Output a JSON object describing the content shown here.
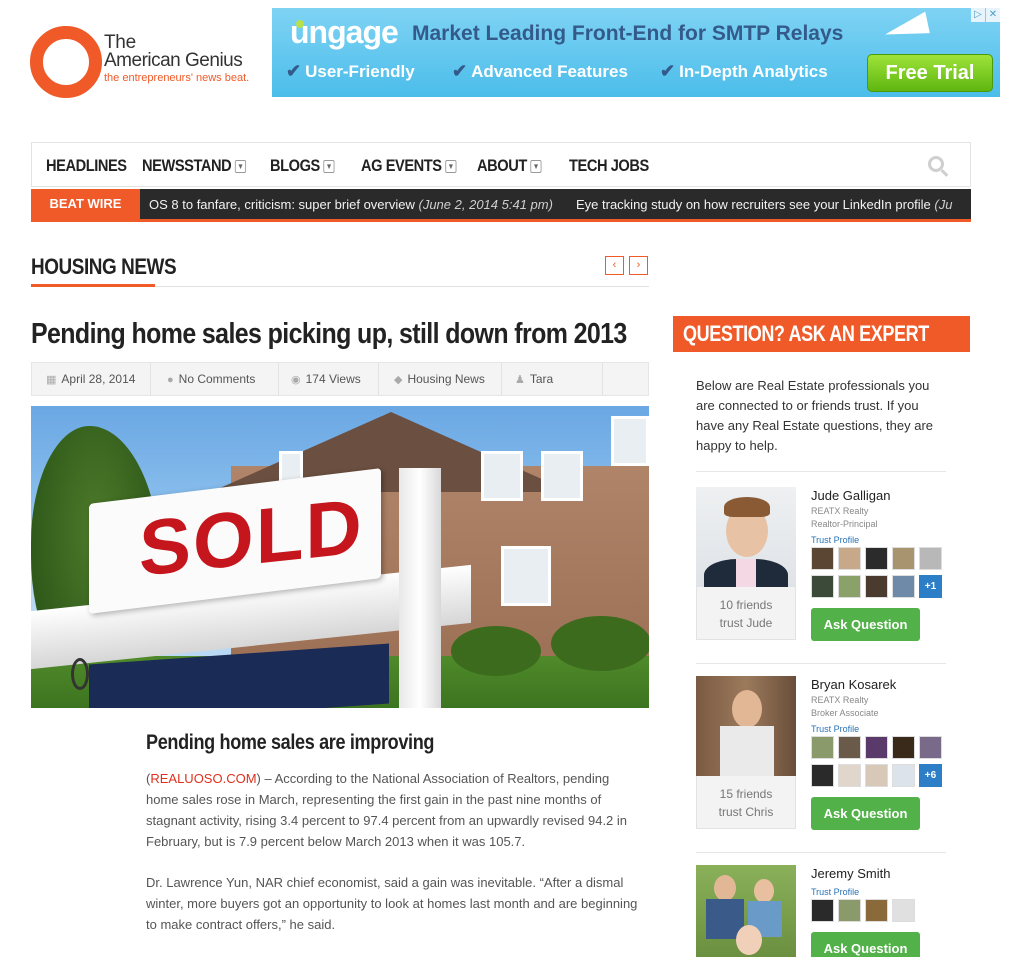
{
  "logo": {
    "line1": "The",
    "line2": "American Genius",
    "tagline": "the entrepreneurs' news beat."
  },
  "ad": {
    "brand": "ungage",
    "title": "Market Leading Front-End for SMTP Relays",
    "features": [
      "User-Friendly",
      "Advanced Features",
      "In-Depth Analytics"
    ],
    "cta": "Free Trial",
    "colors": {
      "background": "#4bbdea",
      "title": "#345a8a",
      "cta": "#6cc11a"
    }
  },
  "nav": {
    "items": [
      {
        "label": "HEADLINES",
        "dropdown": false
      },
      {
        "label": "NEWSSTAND",
        "dropdown": true
      },
      {
        "label": "BLOGS",
        "dropdown": true
      },
      {
        "label": "AG EVENTS",
        "dropdown": true
      },
      {
        "label": "ABOUT",
        "dropdown": true
      },
      {
        "label": "TECH JOBS",
        "dropdown": false
      }
    ],
    "search_icon": "search-icon"
  },
  "beat_wire": {
    "label": "BEAT WIRE",
    "items": [
      {
        "text": "OS 8 to fanfare, criticism: super brief overview",
        "date": "(June 2, 2014 5:41 pm)"
      },
      {
        "text": "Eye tracking study on how recruiters see your LinkedIn profile",
        "date": "(Ju"
      }
    ]
  },
  "section": {
    "title": "HOUSING NEWS",
    "prev": "‹",
    "next": "›"
  },
  "article": {
    "title": "Pending home sales picking up, still down from 2013",
    "meta": {
      "date": "April 28, 2014",
      "comments": "No Comments",
      "views": "174 Views",
      "category": "Housing News",
      "author": "Tara Steele"
    },
    "image_text": "SOLD",
    "subheading": "Pending home sales are improving",
    "source": "REALUOSO.COM",
    "para1": ") – According to the National Association of Realtors, pending home sales rose in March, representing the first gain in the past nine months of stagnant activity, rising 3.4 percent to 97.4 percent from an upwardly revised 94.2 in February, but is 7.9 percent below March 2013 when it was 105.7.",
    "para2": "Dr. Lawrence Yun, NAR chief economist, said a gain was inevitable. “After a dismal winter, more buyers got an opportunity to look at homes last month and are beginning to make contract offers,” he said."
  },
  "sidebar": {
    "title": "QUESTION? ASK AN EXPERT",
    "intro": "Below are Real Estate professionals you are connected to or friends trust. If you have any Real Estate questions, they are happy to help.",
    "agents": [
      {
        "name": "Jude Galligan",
        "company": "REATX Realty",
        "role": "Realtor-Principal",
        "trust_link": "Trust Profile",
        "friends_line1": "10 friends",
        "friends_line2": "trust Jude",
        "more": "+1",
        "button": "Ask Question"
      },
      {
        "name": "Bryan Kosarek",
        "company": "REATX Realty",
        "role": "Broker Associate",
        "trust_link": "Trust Profile",
        "friends_line1": "15 friends",
        "friends_line2": "trust Chris",
        "more": "+6",
        "button": "Ask Question"
      },
      {
        "name": "Jeremy Smith",
        "company": "",
        "role": "",
        "trust_link": "Trust Profile",
        "friends_line1": "",
        "friends_line2": "",
        "more": "",
        "button": "Ask Question"
      }
    ]
  },
  "colors": {
    "accent": "#f05a28",
    "button_green": "#52b149",
    "link_blue": "#2a72b5",
    "link_red": "#e0301e"
  }
}
